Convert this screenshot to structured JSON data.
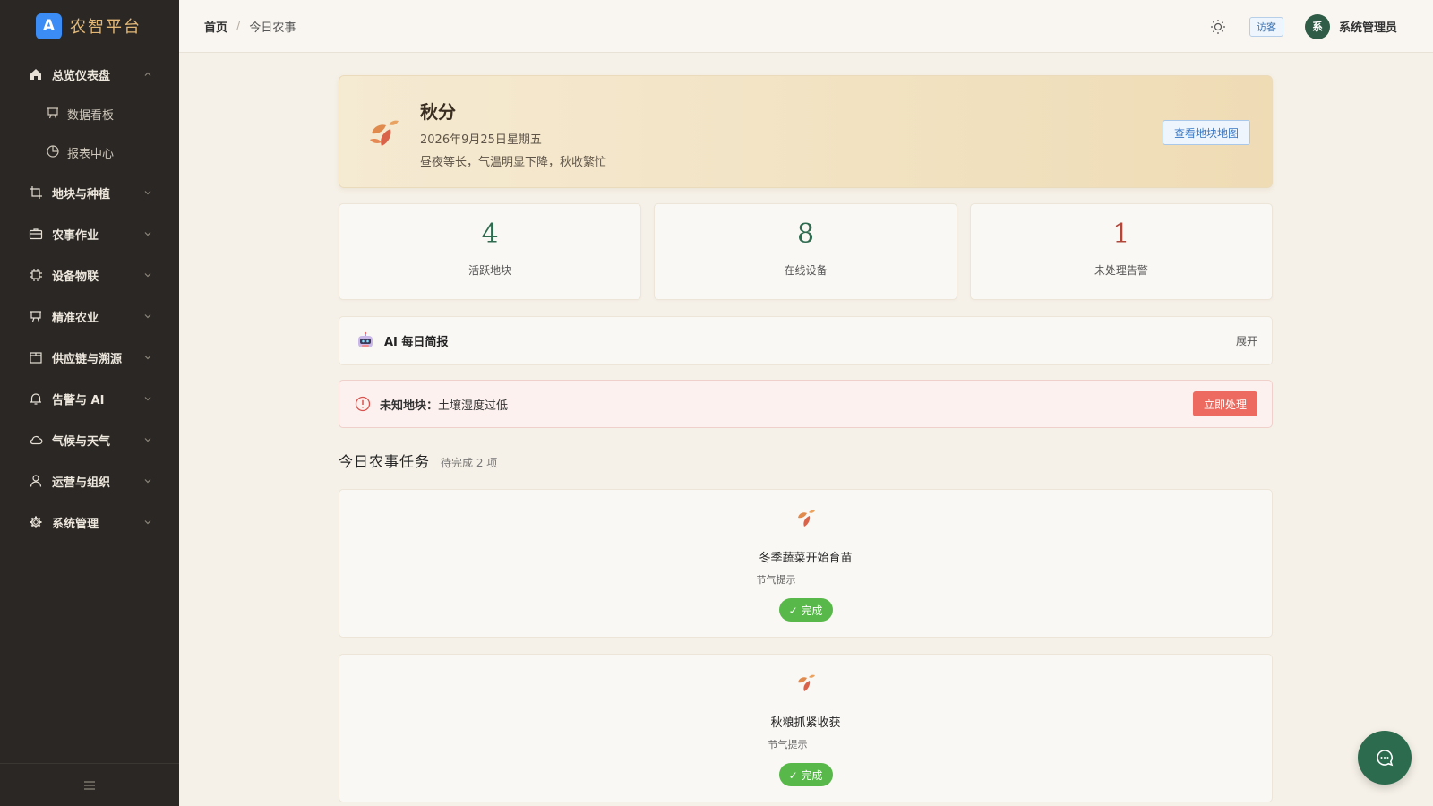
{
  "brand": {
    "logo_letter": "A",
    "name": "农智平台"
  },
  "sidebar": {
    "items": [
      {
        "label": "总览仪表盘",
        "icon": "home-icon",
        "expanded": true,
        "children": [
          {
            "label": "数据看板",
            "icon": "board-icon"
          },
          {
            "label": "报表中心",
            "icon": "pie-icon"
          }
        ]
      },
      {
        "label": "地块与种植",
        "icon": "crop-icon"
      },
      {
        "label": "农事作业",
        "icon": "briefcase-icon"
      },
      {
        "label": "设备物联",
        "icon": "chip-icon"
      },
      {
        "label": "精准农业",
        "icon": "board-icon"
      },
      {
        "label": "供应链与溯源",
        "icon": "package-icon"
      },
      {
        "label": "告警与 AI",
        "icon": "bell-icon"
      },
      {
        "label": "气候与天气",
        "icon": "cloud-icon"
      },
      {
        "label": "运营与组织",
        "icon": "user-icon"
      },
      {
        "label": "系统管理",
        "icon": "gear-icon"
      }
    ]
  },
  "header": {
    "breadcrumb": {
      "home": "首页",
      "sep": "/",
      "current": "今日农事"
    },
    "guest_label": "访客",
    "avatar_letter": "系",
    "user_name": "系统管理员"
  },
  "solar": {
    "title": "秋分",
    "date": "2026年9月25日星期五",
    "desc": "昼夜等长，气温明显下降，秋收繁忙",
    "map_button": "查看地块地图"
  },
  "stats": [
    {
      "value": "4",
      "label": "活跃地块",
      "color": "#2f6b4f"
    },
    {
      "value": "8",
      "label": "在线设备",
      "color": "#2f6b4f"
    },
    {
      "value": "1",
      "label": "未处理告警",
      "color": "#b0473b"
    }
  ],
  "ai_brief": {
    "title": "AI 每日简报",
    "expand": "展开"
  },
  "alert": {
    "field": "未知地块：",
    "message": "土壤湿度过低",
    "button": "立即处理"
  },
  "tasks": {
    "title": "今日农事任务",
    "pending": "待完成 2 项",
    "items": [
      {
        "name": "冬季蔬菜开始育苗",
        "meta": "节气提示",
        "button": "✓ 完成"
      },
      {
        "name": "秋粮抓紧收获",
        "meta": "节气提示",
        "button": "✓ 完成"
      }
    ]
  },
  "colors": {
    "sidebar_bg": "#2a2724",
    "accent_green": "#2c6b4e",
    "alert_red": "#ec6a5f",
    "done_green": "#58b94a",
    "brand_gold": "#e3b877"
  }
}
